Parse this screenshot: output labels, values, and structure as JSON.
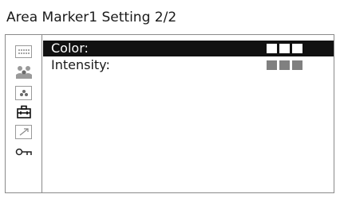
{
  "header": {
    "title": "Area Marker1 Setting 2/2"
  },
  "sidebar": {
    "items": [
      {
        "icon": "paint-dots-icon"
      },
      {
        "icon": "people-icon"
      },
      {
        "icon": "dots-box-icon"
      },
      {
        "icon": "toolbox-icon"
      },
      {
        "icon": "arrow-box-icon"
      },
      {
        "icon": "key-icon"
      }
    ]
  },
  "settings": {
    "rows": [
      {
        "label": "Color:",
        "swatch_color": "#ffffff",
        "selected": true
      },
      {
        "label": "Intensity:",
        "swatch_color": "#808080",
        "selected": false
      }
    ]
  }
}
